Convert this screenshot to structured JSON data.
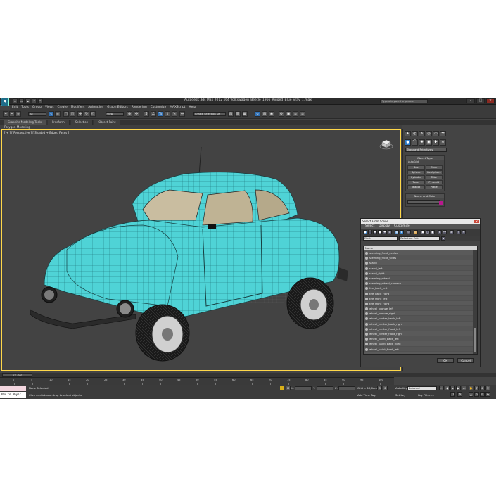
{
  "window": {
    "title": "Autodesk 3ds Max 2012 x64    Volkswagen_Beetle_1966_Rigged_Blue_vray_1.max",
    "search_placeholder": "Type a keyword or phrase",
    "logo_glyph": "S"
  },
  "menu": [
    "Edit",
    "Tools",
    "Group",
    "Views",
    "Create",
    "Modifiers",
    "Animation",
    "Graph Editors",
    "Rendering",
    "Customize",
    "MAXScript",
    "Help"
  ],
  "toolbar": {
    "filter_value": "All",
    "refcoord_value": "View",
    "selection_set_placeholder": "Create Selection Se"
  },
  "ribbon": {
    "tabs": [
      "Graphite Modeling Tools",
      "Freeform",
      "Selection",
      "Object Paint"
    ],
    "active_tab": "Graphite Modeling Tools",
    "sub_label": "Polygon Modeling"
  },
  "viewport": {
    "label": "[ + ] [ Perspective ] [ Shaded + Edged Faces ]",
    "car_color": "#4fd3d6",
    "border_color": "#ffd84a"
  },
  "command_panel": {
    "category": "Standard Primitives",
    "object_type_title": "Object Type",
    "autogrid": "AutoGrid",
    "primitives": [
      "Box",
      "Cone",
      "Sphere",
      "GeoSphere",
      "Cylinder",
      "Tube",
      "Torus",
      "Pyramid",
      "Teapot",
      "Plane"
    ],
    "name_color_title": "Name and Color",
    "swatch_color": "#b8188e"
  },
  "dialog": {
    "title": "Select From Scene",
    "menu": [
      "Select",
      "Display",
      "Customize"
    ],
    "find_label": "Find:",
    "selection_set_label": "Selection Set:",
    "list_header": "Name",
    "items": [
      "steering_front_center",
      "steering_front_sides",
      "stand",
      "stand_left",
      "stand_right",
      "steering_wheel",
      "steering_wheel_chrome",
      "tire_back_left",
      "tire_back_right",
      "tire_front_left",
      "tire_front_right",
      "wheel_bronze_left",
      "wheel_bronze_right",
      "wheel_center_back_left",
      "wheel_center_back_right",
      "wheel_center_front_left",
      "wheel_center_front_right",
      "wheel_paint_back_left",
      "wheel_paint_back_right",
      "wheel_paint_front_left"
    ],
    "ok_label": "OK",
    "cancel_label": "Cancel"
  },
  "timeline": {
    "slider_label": "0 / 100",
    "ticks": [
      "0",
      "5",
      "10",
      "15",
      "20",
      "25",
      "30",
      "35",
      "40",
      "45",
      "50",
      "55",
      "60",
      "65",
      "70",
      "75",
      "80",
      "85",
      "90",
      "95",
      "100"
    ]
  },
  "status": {
    "maxscript_label": "Max to Physc",
    "selection_status": "None Selected",
    "prompt": "Click or click-and-drag to select objects",
    "x_label": "X:",
    "y_label": "Y:",
    "z_label": "Z:",
    "grid": "Grid = 10,0cm",
    "add_time_tag": "Add Time Tag",
    "auto_key": "Auto Key",
    "set_key": "Set Key",
    "selected_value": "Selected",
    "key_filters": "Key Filters..."
  }
}
